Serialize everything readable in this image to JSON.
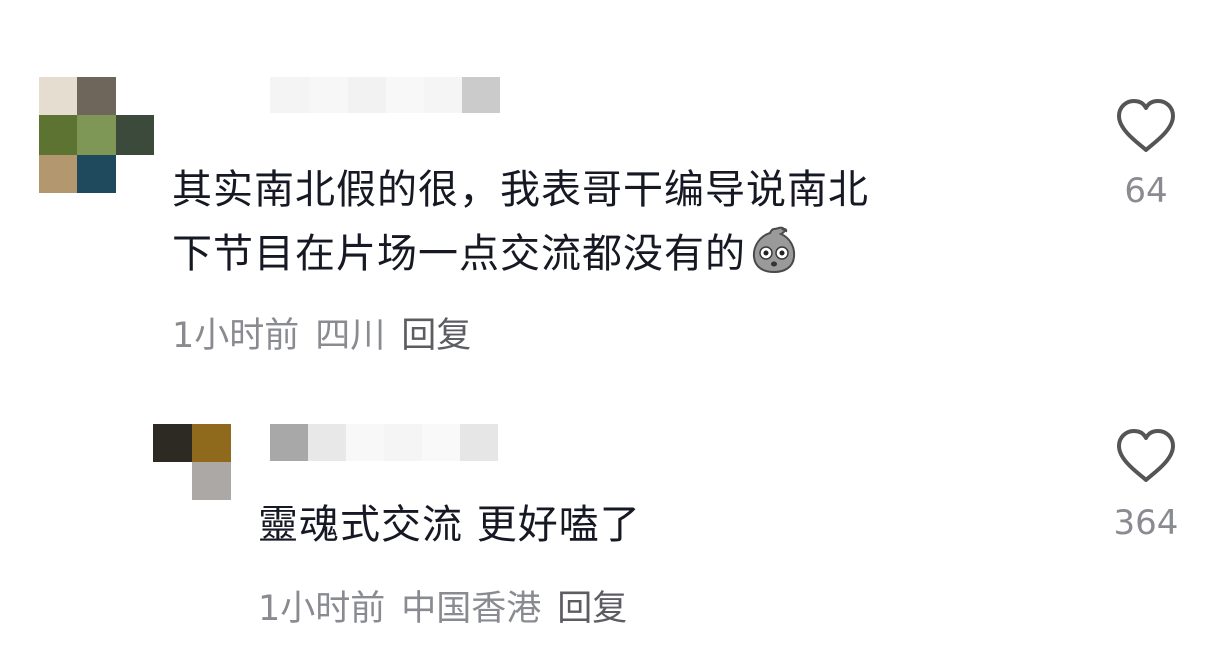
{
  "comments": [
    {
      "text_line_1": "其实南北假的很，我表哥干编导说南北",
      "text_line_2": "下节目在片场一点交流都没有的",
      "emoji": "surprised-blob-emoji",
      "time": "1小时前",
      "location": "四川",
      "reply_label": "回复",
      "likes": "64"
    },
    {
      "text": "靈魂式交流 更好嗑了",
      "time": "1小时前",
      "location": "中国香港",
      "reply_label": "回复",
      "likes": "364"
    }
  ],
  "icons": {
    "like": "heart-outline-icon"
  },
  "colors": {
    "text_primary": "#161823",
    "text_secondary": "#8a8b91",
    "icon": "#555555"
  }
}
